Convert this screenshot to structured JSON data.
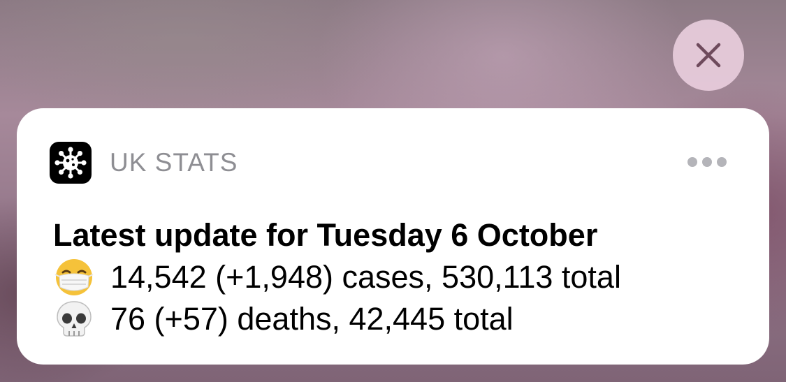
{
  "close_icon_name": "close-icon",
  "notification": {
    "app_icon_name": "virus-icon",
    "app_name": "UK STATS",
    "more_icon_name": "more-icon",
    "title": "Latest update for Tuesday 6 October",
    "lines": [
      {
        "emoji_name": "face-with-medical-mask-icon",
        "text": "14,542 (+1,948) cases, 530,113 total"
      },
      {
        "emoji_name": "skull-icon",
        "text": "76 (+57) deaths, 42,445 total"
      }
    ]
  },
  "colors": {
    "card_bg": "#ffffff",
    "app_name": "#8e8e93",
    "close_button_bg": "#e8cddc",
    "close_glyph": "#6e4a5c"
  }
}
